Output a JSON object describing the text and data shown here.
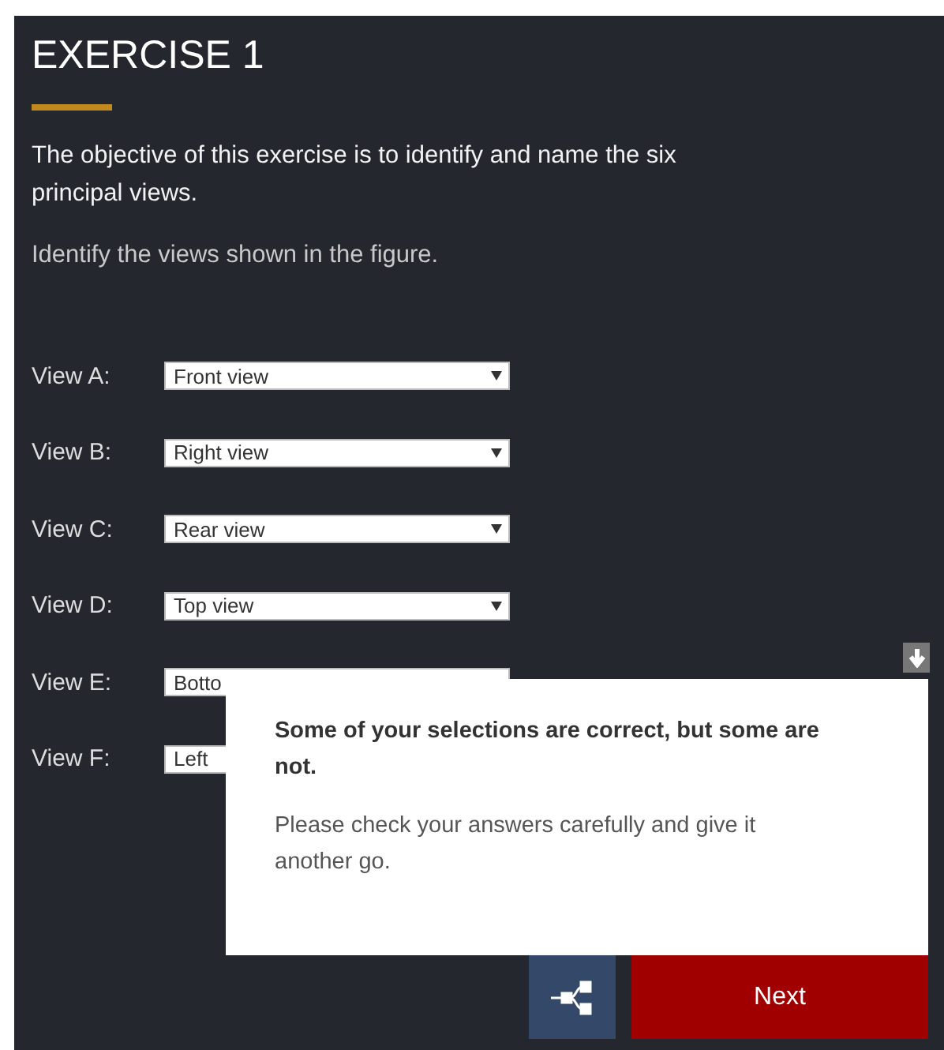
{
  "title": "EXERCISE 1",
  "intro": "The objective of this exercise is to identify and name the six principal views.",
  "instruction": "Identify the views shown in the figure.",
  "views": [
    {
      "label": "View A:",
      "value": "Front view"
    },
    {
      "label": "View B:",
      "value": "Right view"
    },
    {
      "label": "View C:",
      "value": "Rear view"
    },
    {
      "label": "View D:",
      "value": "Top view"
    },
    {
      "label": "View E:",
      "value": "Botto",
      "covered": true
    },
    {
      "label": "View F:",
      "value": "Left",
      "covered": true
    }
  ],
  "feedback": {
    "heading": "Some of your selections are correct, but some are not.",
    "message": "Please check your answers carefully and give it another go."
  },
  "buttons": {
    "next": "Next"
  }
}
